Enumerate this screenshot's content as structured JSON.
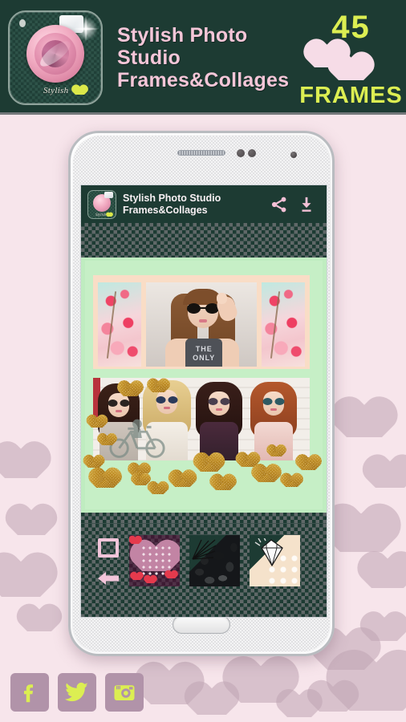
{
  "banner": {
    "app_icon_brand": "Stylish",
    "title_line1": "Stylish Photo Studio",
    "title_line2": "Frames&Collages",
    "badge_count": "45",
    "badge_label": "FRAMES",
    "bg_color": "#1d3b33",
    "title_color": "#f4c6d8",
    "badge_color": "#dcee52",
    "badge_heart_color": "#f6dce7"
  },
  "phone": {
    "hardware": {
      "speaker": "speaker-grille",
      "sensor_left": "proximity-sensor",
      "sensor_right": "light-sensor",
      "front_camera": "front-camera",
      "home_button": "home-button"
    }
  },
  "app_bar": {
    "icon_name": "app-logo-icon",
    "title_line1": "Stylish Photo Studio",
    "title_line2": "Frames&Collages",
    "share_icon": "share-icon",
    "download_icon": "download-icon",
    "bg_color": "#1d3b33",
    "icon_color": "#f4c6d8"
  },
  "canvas": {
    "bg_color": "#c6efc6",
    "frame_color": "#f9ddc6",
    "top_collage": {
      "cells": [
        {
          "name": "floral-pattern-left",
          "type": "pattern"
        },
        {
          "name": "photo-girl-sunglasses",
          "type": "photo",
          "shirt_text_line1": "THE",
          "shirt_text_line2": "ONLY"
        },
        {
          "name": "floral-pattern-right",
          "type": "pattern"
        }
      ]
    },
    "bottom_collage": {
      "name": "photo-four-girls-sunglasses",
      "girls": [
        "brunette",
        "blonde",
        "dark-curly",
        "redhead"
      ]
    },
    "stickers": {
      "bike": "bicycle-sticker",
      "glitter_hearts_count": "17",
      "glitter_heart_color": "#d9980f"
    }
  },
  "toolbar": {
    "frame_button": "frame-icon",
    "back_button": "back-arrow-icon",
    "accent_color": "#f2c5da",
    "thumbnails": [
      {
        "name": "thumb-polka-heart",
        "label": "Polka Heart"
      },
      {
        "name": "thumb-black-confetti",
        "label": "Black Confetti"
      },
      {
        "name": "thumb-diamond-bows",
        "label": "Diamond Bows"
      }
    ]
  },
  "social": {
    "buttons": [
      {
        "name": "facebook-button",
        "glyph": "f",
        "label": "Facebook"
      },
      {
        "name": "twitter-button",
        "glyph": "twitter-bird",
        "label": "Twitter"
      },
      {
        "name": "instagram-button",
        "glyph": "instagram-camera",
        "label": "Instagram"
      }
    ],
    "bg_color": "#b193a9",
    "glyph_color": "#dcee52"
  },
  "background": {
    "color": "#f7e5eb",
    "heart_color": "#c0a5b4"
  }
}
